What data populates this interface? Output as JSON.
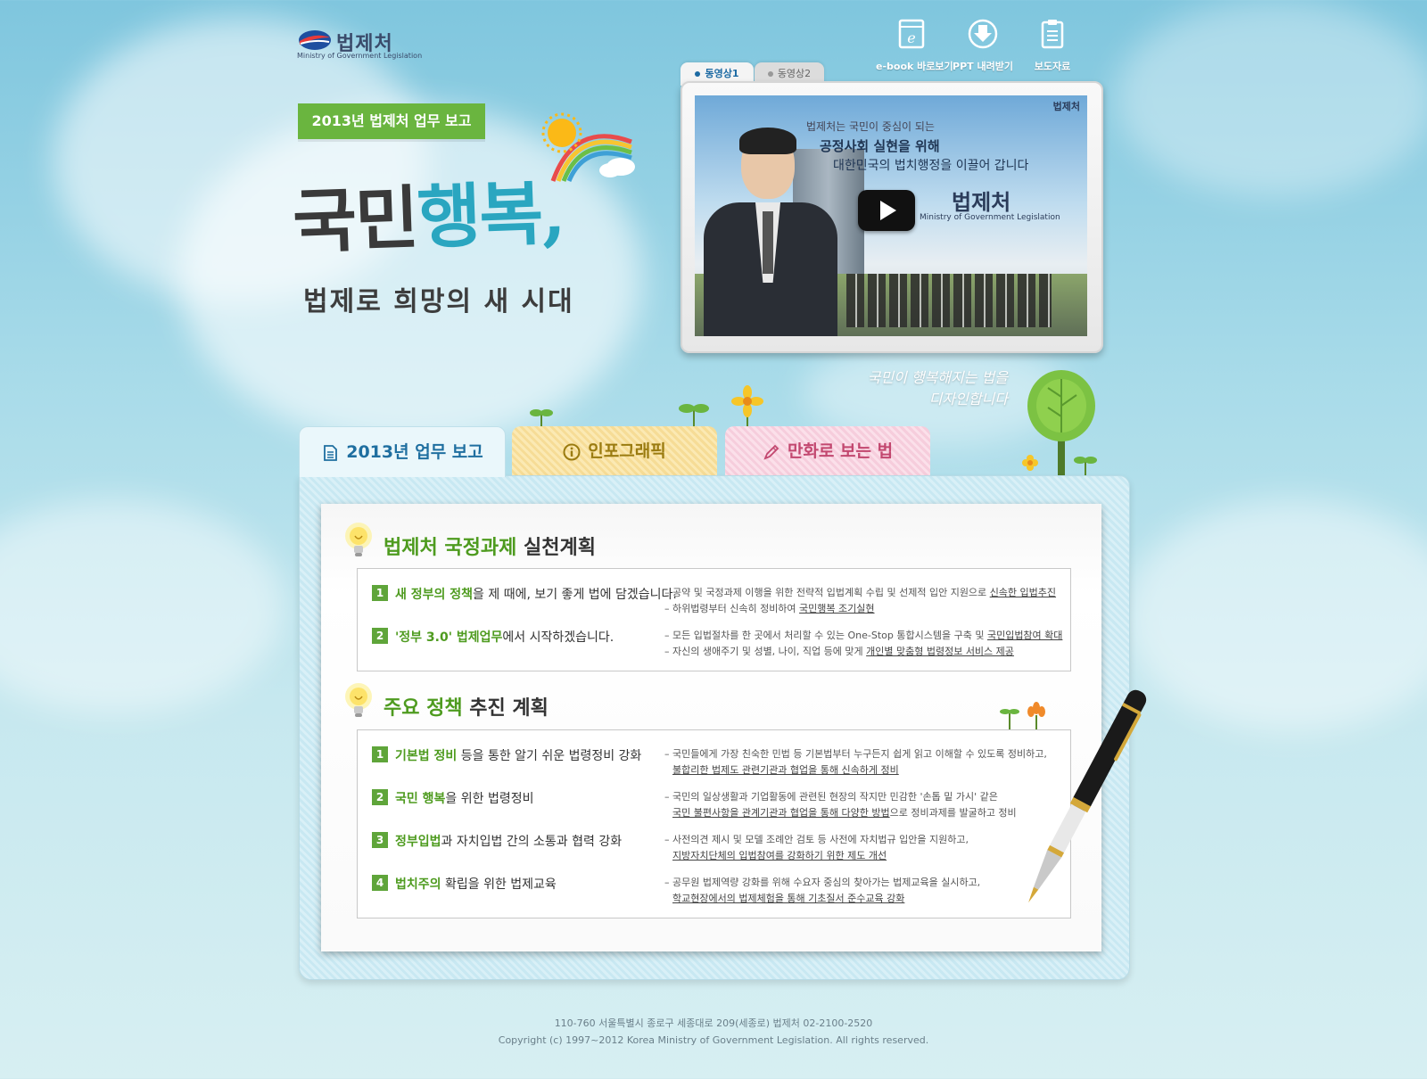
{
  "logo": {
    "name_ko": "법제처",
    "name_en": "Ministry of Government Legislation"
  },
  "utility": [
    {
      "label": "e-book 바로보기",
      "icon": "ebook-icon"
    },
    {
      "label": "PPT 내려받기",
      "icon": "download-icon"
    },
    {
      "label": "보도자료",
      "icon": "clipboard-icon"
    }
  ],
  "video": {
    "tabs": [
      "동영상1",
      "동영상2"
    ],
    "screen": {
      "line1": "법제처는 국민이 중심이 되는",
      "line2": "공정사회 실현을 위해",
      "line3": "대한민국의 법치행정을 이끌어 갑니다",
      "logo_ko": "법제처",
      "logo_en": "Ministry of Government Legislation",
      "corner": "법제처"
    }
  },
  "hero": {
    "tag": "2013년 법제처 업무 보고",
    "title_part1": "국민",
    "title_part2": "행복",
    "title_part3": ",",
    "subtitle": "법제로 희망의 새 시대",
    "slogan_line1": "국민이 행복해지는 법을",
    "slogan_line2": "디자인합니다"
  },
  "tabs": [
    {
      "label": "2013년 업무 보고",
      "icon": "document-icon"
    },
    {
      "label": "인포그래픽",
      "icon": "info-icon"
    },
    {
      "label": "만화로 보는 법",
      "icon": "pencil-icon"
    }
  ],
  "section1": {
    "title_green": "법제처 국정과제",
    "title_rest": " 실천계획",
    "items": [
      {
        "num": "1",
        "green": "새 정부의 정책",
        "rest": "을 제 때에, 보기 좋게 법에 담겠습니다.",
        "desc1_pre": "– 공약 및 국정과제 이행을 위한 전략적 입법계획 수립 및 선제적 입안 지원으로 ",
        "desc1_u": "신속한 입법추진",
        "desc2_pre": "– 하위법령부터 신속히 정비하여 ",
        "desc2_u": "국민행복 조기실현"
      },
      {
        "num": "2",
        "green": "'정부 3.0' 법제업무",
        "rest": "에서 시작하겠습니다.",
        "desc1_pre": "– 모든 입법절차를 한 곳에서 처리할 수 있는 One-Stop 통합시스템을 구축 및 ",
        "desc1_u": "국민입법참여 확대",
        "desc2_pre": "– 자신의 생애주기 및 성별, 나이, 직업 등에 맞게 ",
        "desc2_u": "개인별 맞춤형 법령정보 서비스 제공"
      }
    ]
  },
  "section2": {
    "title_green": "주요 정책",
    "title_rest": " 추진 계획",
    "items": [
      {
        "num": "1",
        "green": "기본법 정비",
        "rest": " 등을 통한 알기 쉬운 법령정비 강화",
        "desc1": "– 국민들에게 가장 친숙한 민법 등 기본법부터 누구든지 쉽게 읽고 이해할 수 있도록 정비하고,",
        "desc2_u": "불합리한 법제도 관련기관과 협업을 통해 신속하게 정비",
        "desc2_post": ""
      },
      {
        "num": "2",
        "green": "국민 행복",
        "rest": "을 위한 법령정비",
        "desc1": "– 국민의 일상생활과 기업활동에 관련된 현장의 작지만 민감한 '손톱 밑 가시' 같은",
        "desc2_u": "국민 불편사항을 관계기관과 협업을 통해 다양한 방법",
        "desc2_post": "으로 정비과제를 발굴하고 정비"
      },
      {
        "num": "3",
        "green": "정부입법",
        "rest": "과 자치입법 간의 소통과 협력 강화",
        "desc1": "– 사전의견 제시 및 모델 조례안 검토 등 사전에 자치법규 입안을 지원하고,",
        "desc2_u": "지방자치단체의 입법참여를 강화하기 위한 제도 개선",
        "desc2_post": ""
      },
      {
        "num": "4",
        "green": "법치주의",
        "rest": " 확립을 위한 법제교육",
        "desc1": "– 공무원 법제역량 강화를 위해 수요자 중심의 찾아가는 법제교육을 실시하고,",
        "desc2_u": "학교현장에서의 법제체험을 통해 기초질서 준수교육 강화",
        "desc2_post": ""
      }
    ]
  },
  "footer": {
    "address": "110-760 서울특별시 종로구 세종대로 209(세종로) 법제처 02-2100-2520",
    "copyright": "Copyright (c) 1997~2012 Korea Ministry of Government Legislation. All rights reserved."
  },
  "colors": {
    "accent_green": "#6ab53f",
    "accent_blue": "#2aa6c0",
    "tab_blue_text": "#1f6fa0"
  }
}
